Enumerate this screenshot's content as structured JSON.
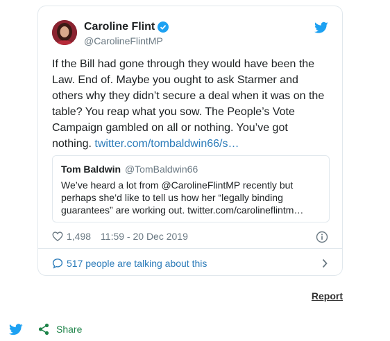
{
  "tweet": {
    "author_name": "Caroline Flint",
    "author_handle": "@CarolineFlintMP",
    "text_main": "If the Bill had gone through they would have been the Law. End of. Maybe you ought to ask Starmer and others why they didn’t secure a deal when it was on the table? You reap what you sow. The People’s Vote Campaign gambled on all or nothing. You’ve got nothing. ",
    "text_link": "twitter.com/tombaldwin66/s…",
    "likes": "1,498",
    "timestamp": "11:59 - 20 Dec 2019",
    "talking": "517 people are talking about this"
  },
  "quote": {
    "name": "Tom Baldwin",
    "handle": "@TomBaldwin66",
    "text": "We’ve heard a lot from @CarolineFlintMP recently but perhaps she’d like to tell us how her “legally binding guarantees” are working out. twitter.com/carolineflintm…"
  },
  "page": {
    "report": "Report",
    "share": "Share"
  },
  "colors": {
    "twitter_blue": "#1da1f2",
    "link_blue": "#2b7bb9",
    "share_green": "#1d8348"
  },
  "icons": [
    "verified-icon",
    "twitter-logo-icon",
    "heart-icon",
    "info-icon",
    "comment-icon",
    "chevron-right-icon",
    "share-icon"
  ]
}
